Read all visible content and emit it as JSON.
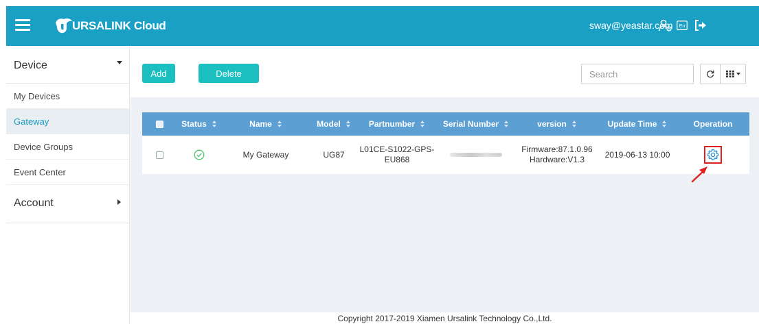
{
  "header": {
    "brand": "URSALINK Cloud",
    "user_email": "sway@yeastar.com",
    "colors": {
      "header_bg": "#1aa0c4",
      "accent": "#1cbfbf",
      "table_header": "#5c9fd3"
    },
    "icons": [
      "menu-icon",
      "user-settings-icon",
      "language-icon",
      "logout-icon"
    ]
  },
  "sidebar": {
    "device_group": "Device",
    "items": [
      {
        "label": "My Devices"
      },
      {
        "label": "Gateway"
      },
      {
        "label": "Device Groups"
      },
      {
        "label": "Event Center"
      }
    ],
    "active_item": "Gateway",
    "account_group": "Account"
  },
  "toolbar": {
    "add_label": "Add",
    "delete_label": "Delete",
    "search_placeholder": "Search"
  },
  "table": {
    "columns": [
      "Status",
      "Name",
      "Model",
      "Partnumber",
      "Serial Number",
      "version",
      "Update Time",
      "Operation"
    ],
    "rows": [
      {
        "status": "online",
        "name": "My Gateway",
        "model": "UG87",
        "partnumber_line1": "L01CE-S1022-GPS-",
        "partnumber_line2": "EU868",
        "serial_number": "",
        "version_firmware": "Firmware:87.1.0.96",
        "version_hardware": "Hardware:V1.3",
        "update_time": "2019-06-13 10:00"
      }
    ]
  },
  "footer": {
    "copyright": "Copyright 2017-2019 Xiamen Ursalink Technology Co.,Ltd."
  }
}
